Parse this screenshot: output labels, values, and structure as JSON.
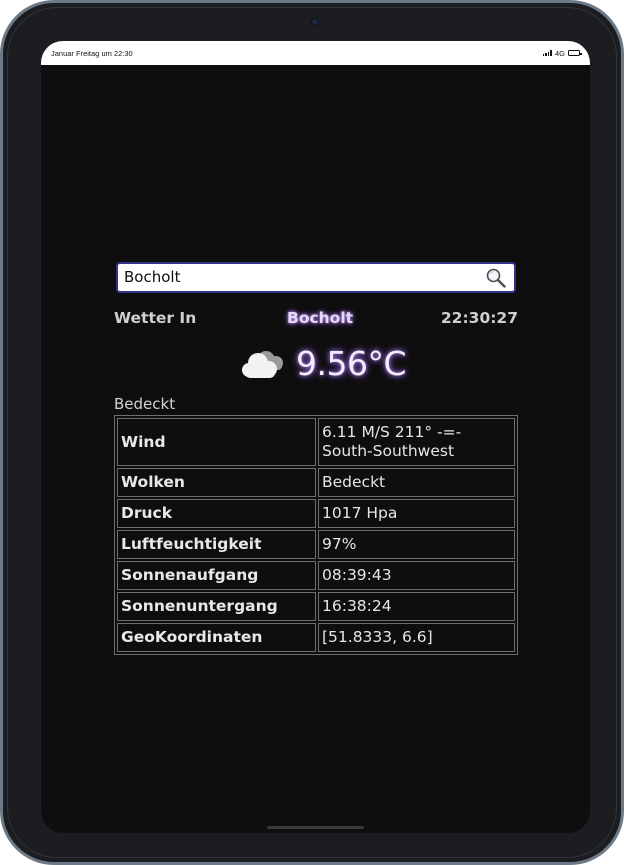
{
  "status_bar": {
    "datetime": "Januar Freitag um 22:30",
    "network": "4G"
  },
  "search": {
    "value": "Bocholt",
    "icon": "search-icon"
  },
  "header": {
    "prefix": "Wetter In",
    "city": "Bocholt",
    "time": "22:30:27"
  },
  "current": {
    "icon": "cloud-icon",
    "temperature": "9.56°C",
    "condition": "Bedeckt"
  },
  "details": [
    {
      "label": "Wind",
      "value": "6.11 M/S 211° -=- South-Southwest"
    },
    {
      "label": "Wolken",
      "value": "Bedeckt"
    },
    {
      "label": "Druck",
      "value": "1017 Hpa"
    },
    {
      "label": "Luftfeuchtigkeit",
      "value": "97%"
    },
    {
      "label": "Sonnenaufgang",
      "value": "08:39:43"
    },
    {
      "label": "Sonnenuntergang",
      "value": "16:38:24"
    },
    {
      "label": "GeoKoordinaten",
      "value": "[51.8333, 6.6]"
    }
  ],
  "colors": {
    "screen_background": "#0e0e0e",
    "search_border": "#33338a",
    "glow_accent": "#a77de6",
    "device_frame": "#1b1d20"
  }
}
